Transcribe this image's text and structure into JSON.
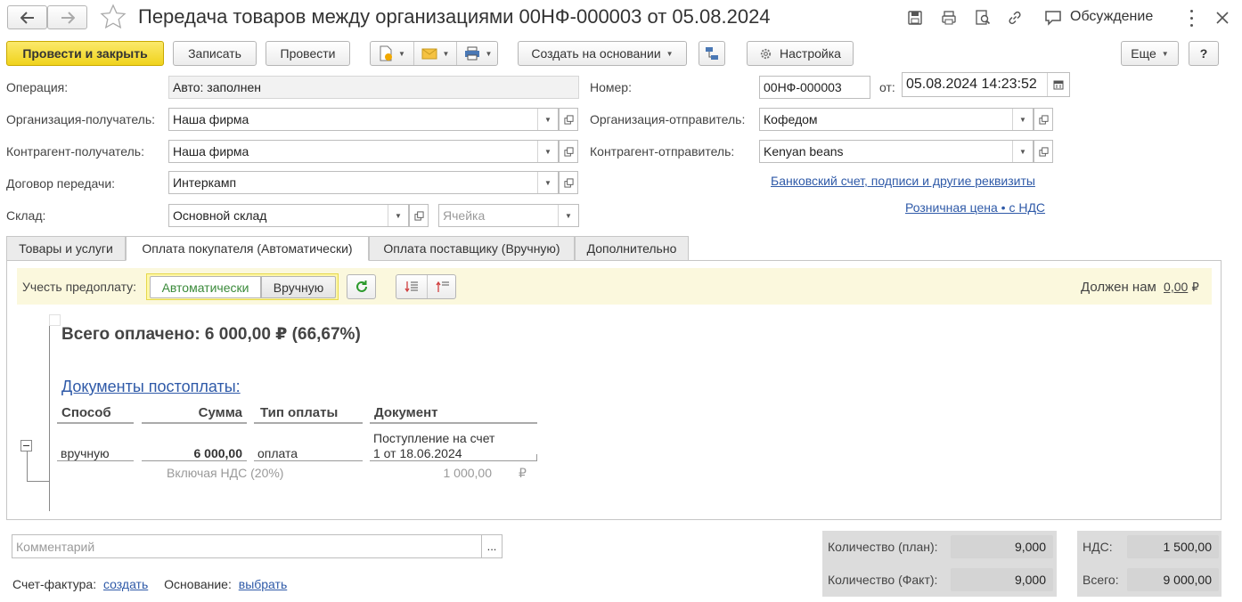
{
  "window": {
    "title": "Передача товаров между организациями 00НФ-000003 от 05.08.2024",
    "discussion_label": "Обсуждение"
  },
  "toolbar": {
    "post_close": "Провести и закрыть",
    "save": "Записать",
    "post": "Провести",
    "create_based": "Создать на основании",
    "settings": "Настройка",
    "more": "Еще",
    "help": "?"
  },
  "header": {
    "operation_label": "Операция:",
    "operation_value": "Авто: заполнен",
    "number_label": "Номер:",
    "number_value": "00НФ-000003",
    "date_label": "от:",
    "date_value": "05.08.2024 14:23:52",
    "org_recv_label": "Организация-получатель:",
    "org_recv_value": "Наша фирма",
    "org_send_label": "Организация-отправитель:",
    "org_send_value": "Кофедом",
    "contr_recv_label": "Контрагент-получатель:",
    "contr_recv_value": "Наша фирма",
    "contr_send_label": "Контрагент-отправитель:",
    "contr_send_value": "Kenyan beans",
    "contract_label": "Договор передачи:",
    "contract_value": "Интеркамп",
    "warehouse_label": "Склад:",
    "warehouse_value": "Основной склад",
    "cell_placeholder": "Ячейка",
    "bank_link": "Банковский счет, подписи и другие реквизиты",
    "retail_link": "Розничная цена • с НДС"
  },
  "tabs": [
    {
      "label": "Товары и услуги"
    },
    {
      "label": "Оплата покупателя (Автоматически)"
    },
    {
      "label": "Оплата поставщику (Вручную)"
    },
    {
      "label": "Дополнительно"
    }
  ],
  "payment": {
    "prepay_label": "Учесть предоплату:",
    "auto": "Автоматически",
    "manual": "Вручную",
    "owes_label": "Должен нам",
    "owes_value": "0,00",
    "currency": "₽",
    "total_paid": "Всего оплачено: 6 000,00 ₽ (66,67%)",
    "postpay_header": "Документы постоплаты:",
    "columns": [
      "Способ",
      "Сумма",
      "Тип оплаты",
      "Документ"
    ],
    "row": {
      "method": "вручную",
      "amount": "6 000,00",
      "type": "оплата",
      "doc_line1": "Поступление на счет",
      "doc_line2": "1 от 18.06.2024",
      "vat_label": "Включая НДС (20%)",
      "vat_amount": "1 000,00",
      "vat_currency": "₽"
    }
  },
  "footer": {
    "comment_placeholder": "Комментарий",
    "comment_btn": "...",
    "invoice_label": "Счет-фактура:",
    "invoice_link": "создать",
    "basis_label": "Основание:",
    "basis_link": "выбрать",
    "qty_plan_label": "Количество (план):",
    "qty_plan_value": "9,000",
    "qty_fact_label": "Количество (Факт):",
    "qty_fact_value": "9,000",
    "vat_label": "НДС:",
    "vat_value": "1 500,00",
    "total_label": "Всего:",
    "total_value": "9 000,00"
  },
  "colors": {
    "accent_yellow": "#f0d31c",
    "link_blue": "#2f5aa8",
    "prepay_bar": "#fbf8dd",
    "auto_green": "#3a8a3a"
  }
}
